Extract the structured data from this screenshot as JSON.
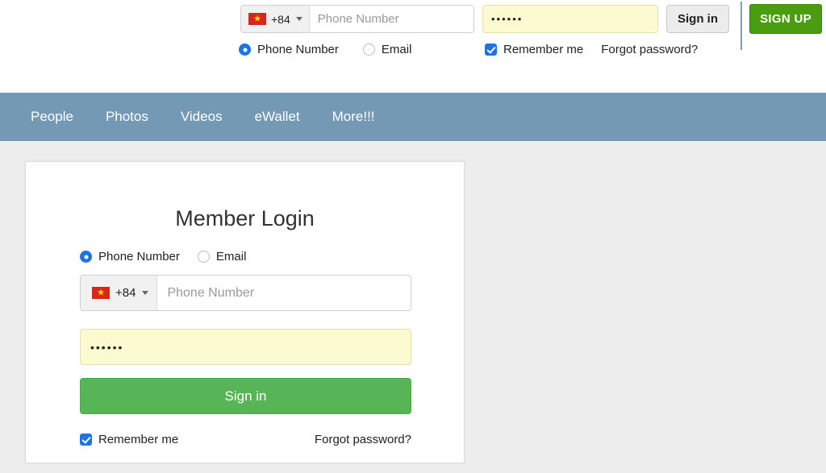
{
  "header": {
    "country": {
      "flag_icon": "vietnam-flag-icon",
      "dial_code": "+84",
      "star_glyph": "★"
    },
    "phone_placeholder": "Phone Number",
    "password_value": "••••••",
    "signin_label": "Sign in",
    "signup_label": "SIGN UP",
    "radio_phone_label": "Phone Number",
    "radio_email_label": "Email",
    "remember_label": "Remember me",
    "forgot_label": "Forgot password?"
  },
  "navbar": {
    "items": [
      {
        "label": "People"
      },
      {
        "label": "Photos"
      },
      {
        "label": "Videos"
      },
      {
        "label": "eWallet"
      },
      {
        "label": "More!!!"
      }
    ]
  },
  "card": {
    "title": "Member Login",
    "radio_phone_label": "Phone Number",
    "radio_email_label": "Email",
    "country": {
      "flag_icon": "vietnam-flag-icon",
      "dial_code": "+84",
      "star_glyph": "★"
    },
    "phone_placeholder": "Phone Number",
    "password_value": "••••••",
    "signin_label": "Sign in",
    "remember_label": "Remember me",
    "forgot_label": "Forgot password?"
  },
  "colors": {
    "navbar": "#7399b5",
    "page_background": "#ededed",
    "primary_green": "#57b558",
    "signup_green": "#4a9c10",
    "accent_blue": "#1a73e8",
    "autofill_yellow": "#fcfad1",
    "flag_red": "#da251d",
    "flag_star": "#ffe000"
  }
}
